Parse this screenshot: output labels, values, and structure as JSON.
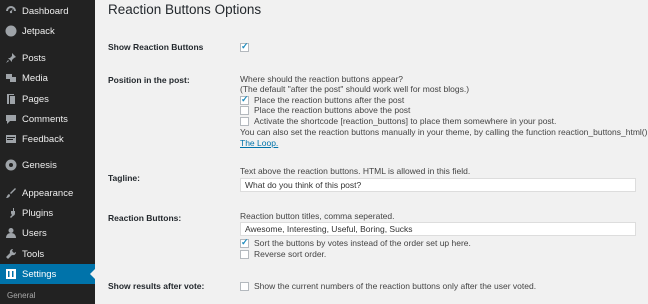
{
  "sidebar": {
    "items": [
      {
        "label": "Dashboard",
        "icon": "dashboard-icon"
      },
      {
        "label": "Jetpack",
        "icon": "jetpack-icon"
      },
      {
        "label": "Posts",
        "icon": "posts-pin-icon"
      },
      {
        "label": "Media",
        "icon": "media-icon"
      },
      {
        "label": "Pages",
        "icon": "pages-icon"
      },
      {
        "label": "Comments",
        "icon": "comments-icon"
      },
      {
        "label": "Feedback",
        "icon": "feedback-icon"
      },
      {
        "label": "Genesis",
        "icon": "genesis-icon"
      },
      {
        "label": "Appearance",
        "icon": "appearance-brush-icon"
      },
      {
        "label": "Plugins",
        "icon": "plugins-icon"
      },
      {
        "label": "Users",
        "icon": "users-icon"
      },
      {
        "label": "Tools",
        "icon": "tools-wrench-icon"
      },
      {
        "label": "Settings",
        "icon": "settings-icon",
        "active": true
      }
    ],
    "submenu_label": "General"
  },
  "page_title": "Reaction Buttons Options",
  "show_buttons": {
    "label": "Show Reaction Buttons",
    "checked": true
  },
  "position": {
    "label": "Position in the post:",
    "desc1": "Where should the reaction buttons appear?",
    "desc2": "(The default \"after the post\" should work well for most blogs.)",
    "options": [
      {
        "label": "Place the reaction buttons after the post",
        "checked": true
      },
      {
        "label": "Place the reaction buttons above the post",
        "checked": false
      },
      {
        "label": "Activate the shortcode [reaction_buttons] to place them somewhere in your post.",
        "checked": false
      }
    ],
    "note": "You can also set the reaction buttons manually in your theme, by calling the function reaction_buttons_html(). E",
    "link": "The Loop."
  },
  "tagline": {
    "label": "Tagline:",
    "desc": "Text above the reaction buttons. HTML is allowed in this field.",
    "value": "What do you think of this post?"
  },
  "reaction_buttons": {
    "label": "Reaction Buttons:",
    "desc": "Reaction button titles, comma seperated.",
    "value": "Awesome, Interesting, Useful, Boring, Sucks",
    "options": [
      {
        "label": "Sort the buttons by votes instead of the order set up here.",
        "checked": true
      },
      {
        "label": "Reverse sort order.",
        "checked": false
      }
    ]
  },
  "results_after_vote": {
    "label": "Show results after vote:",
    "option": {
      "label": "Show the current numbers of the reaction buttons only after the user voted.",
      "checked": false
    }
  },
  "colors": {
    "sidebar_bg": "#222222",
    "active_bg": "#0073aa",
    "content_bg": "#f1f1f1",
    "link": "#0073aa"
  }
}
